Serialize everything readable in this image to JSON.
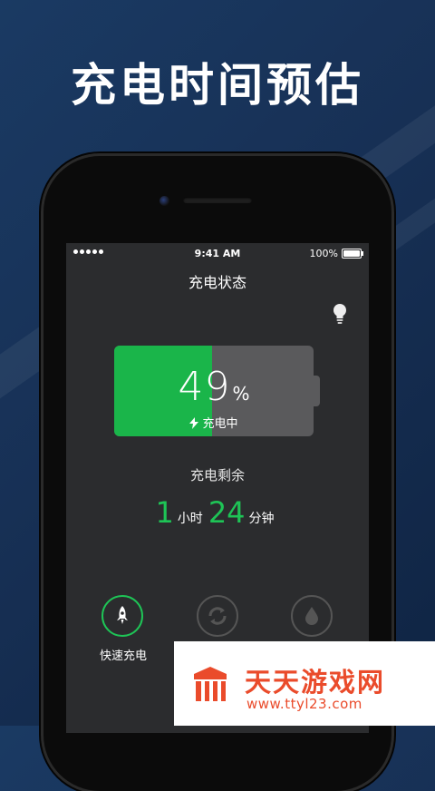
{
  "headline": "充电时间预估",
  "status_bar": {
    "time": "9:41 AM",
    "battery": "100%"
  },
  "screen": {
    "title": "充电状态",
    "battery": {
      "percent_value": 49,
      "percent_text": "49",
      "percent_unit": "%",
      "state_label": "充电中"
    },
    "remaining": {
      "label": "充电剩余",
      "hours": "1",
      "hours_unit": "小时",
      "minutes": "24",
      "minutes_unit": "分钟"
    },
    "modes": [
      {
        "label": "快速充电",
        "icon": "rocket-icon",
        "active": true
      },
      {
        "label": "",
        "icon": "cycle-icon",
        "active": false
      },
      {
        "label": "",
        "icon": "drop-icon",
        "active": false
      }
    ]
  },
  "watermark": {
    "title": "天天游戏网",
    "url": "www.ttyl23.com"
  },
  "colors": {
    "accent_green": "#1ec456",
    "battery_green": "#1ab54a",
    "watermark_red": "#ea4b2b"
  }
}
